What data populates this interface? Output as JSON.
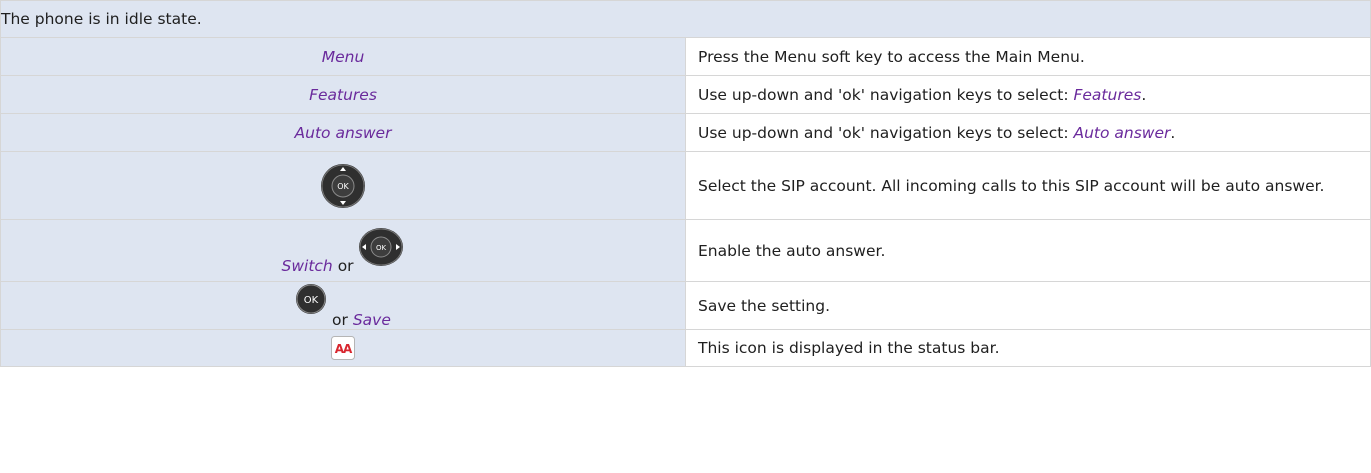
{
  "header": "The phone is in idle state.",
  "rows": [
    {
      "left": "Menu",
      "right": "Press the Menu soft key to access the Main Menu."
    },
    {
      "left": "Features",
      "right_prefix": "Use up-down and 'ok' navigation keys to select: ",
      "right_kw": "Features",
      "right_suffix": "."
    },
    {
      "left": "Auto answer",
      "right_prefix": "Use up-down and 'ok' navigation keys to select: ",
      "right_kw": "Auto answer",
      "right_suffix": "."
    },
    {
      "left_icon": "ok-navigation-updown-icon",
      "right": "Select the SIP account. All incoming calls to this SIP account will be auto answer."
    },
    {
      "left": "Switch",
      "left_or": "or",
      "left_icon": "ok-navigation-leftright-icon",
      "right": "Enable the auto answer."
    },
    {
      "left_icon": "ok-button-icon",
      "left_or": "or",
      "left": "Save",
      "right": "Save the setting."
    },
    {
      "left_icon": "auto-answer-status-icon",
      "right": "This icon is displayed in the status bar."
    }
  ],
  "icons": {
    "ok_label": "OK",
    "status_letters": "AA"
  },
  "colors": {
    "left_cell_bg": "#dee5f1",
    "keyword": "#6a2a9c",
    "key_dark": "#2f2f2f",
    "status_red": "#d8262e"
  }
}
